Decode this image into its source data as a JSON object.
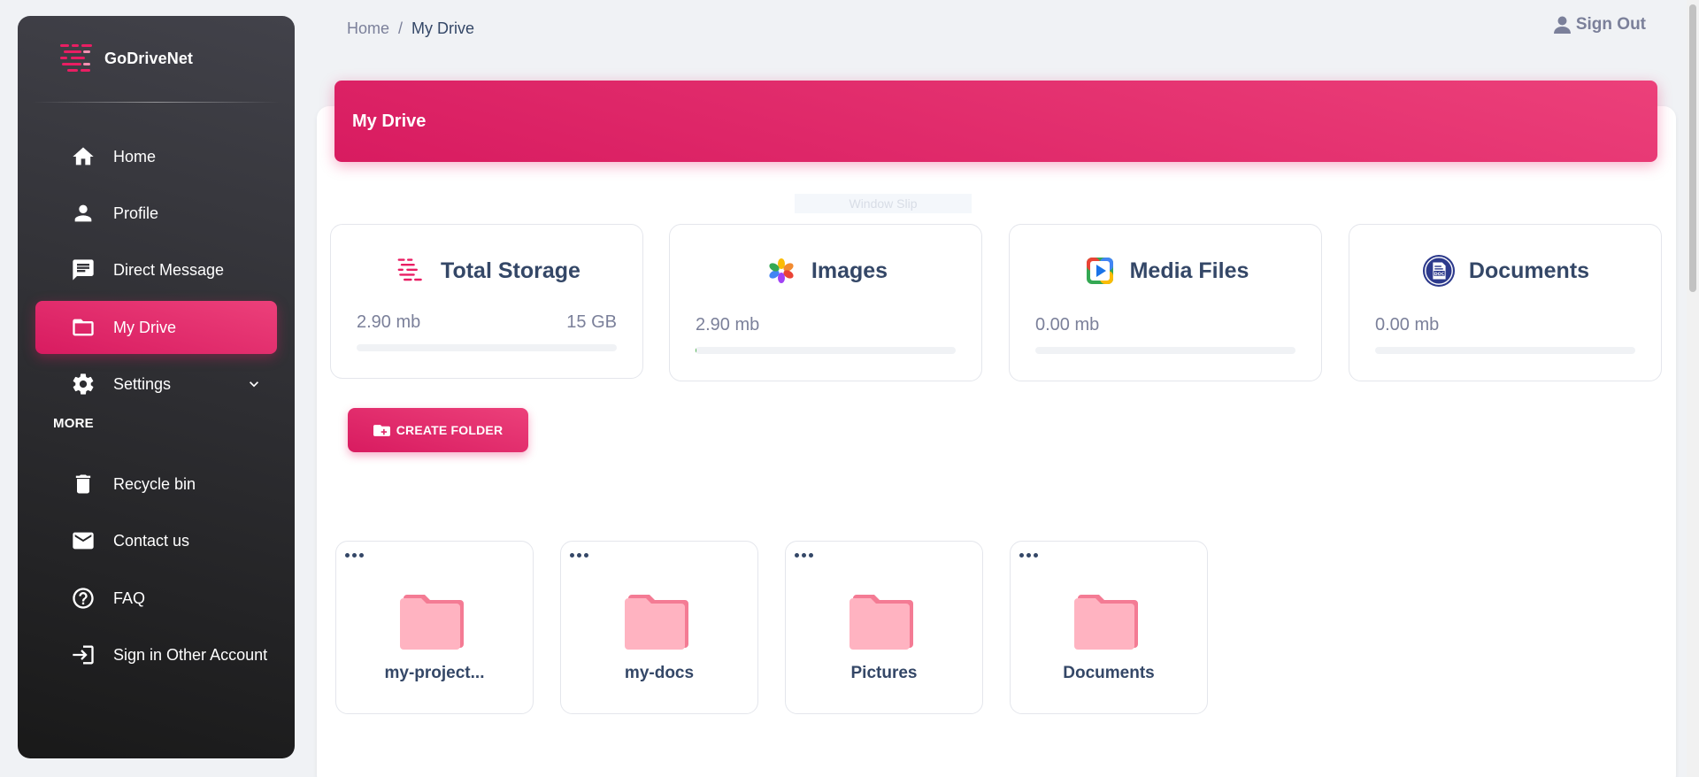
{
  "app": {
    "name": "GoDriveNet"
  },
  "sidebar": {
    "items": [
      {
        "label": "Home",
        "icon": "home-icon"
      },
      {
        "label": "Profile",
        "icon": "person-icon"
      },
      {
        "label": "Direct Message",
        "icon": "message-icon"
      },
      {
        "label": "My Drive",
        "icon": "folder-icon",
        "active": true
      },
      {
        "label": "Settings",
        "icon": "gear-icon"
      }
    ],
    "more_title": "MORE",
    "more_items": [
      {
        "label": "Recycle bin",
        "icon": "trash-icon"
      },
      {
        "label": "Contact us",
        "icon": "mail-icon"
      },
      {
        "label": "FAQ",
        "icon": "help-icon"
      },
      {
        "label": "Sign in Other Account",
        "icon": "login-icon"
      }
    ]
  },
  "breadcrumb": {
    "home": "Home",
    "separator": "/",
    "current": "My Drive"
  },
  "header": {
    "signout_label": "Sign Out"
  },
  "drive": {
    "title": "My Drive",
    "faint_label": "Window Slip",
    "stats": [
      {
        "title": "Total Storage",
        "used": "2.90 mb",
        "total": "15 GB",
        "fill": 0
      },
      {
        "title": "Images",
        "used": "2.90 mb",
        "fill": 0.004
      },
      {
        "title": "Media Files",
        "used": "0.00 mb",
        "fill": 0
      },
      {
        "title": "Documents",
        "used": "0.00 mb",
        "fill": 0
      }
    ],
    "create_folder_label": "CREATE FOLDER",
    "folders": [
      {
        "name": "my-project..."
      },
      {
        "name": "my-docs"
      },
      {
        "name": "Pictures"
      },
      {
        "name": "Documents"
      }
    ]
  },
  "colors": {
    "accent": "#e91e63",
    "sidebar_dark": "#191919",
    "text_dark": "#344767",
    "text_muted": "#7b809a",
    "progress": "#4caf50",
    "folder_pink": "#ffb3c1"
  }
}
